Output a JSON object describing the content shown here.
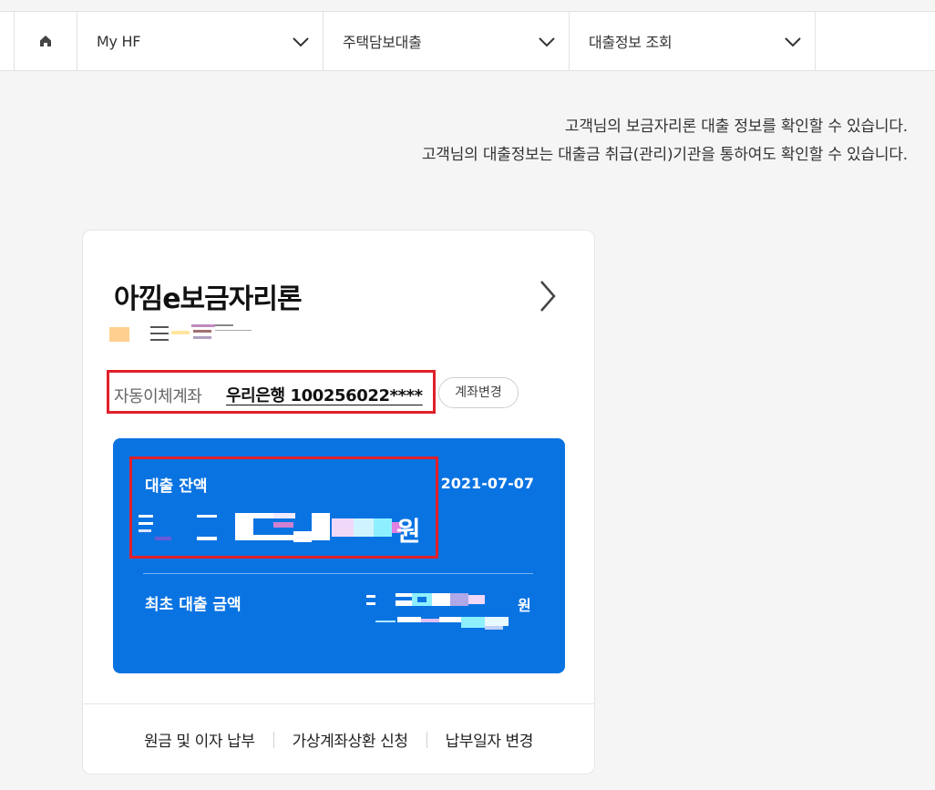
{
  "nav": {
    "home_icon": "home-icon",
    "items": [
      {
        "label": "My HF"
      },
      {
        "label": "주택담보대출"
      },
      {
        "label": "대출정보 조회"
      }
    ]
  },
  "intro": {
    "line1": "고객님의 보금자리론 대출 정보를 확인할 수 있습니다.",
    "line2": "고객님의 대출정보는 대출금 취급(관리)기관을 통하여도 확인할 수 있습니다."
  },
  "card": {
    "title": "아낌e보금자리론",
    "autopay_label": "자동이체계좌",
    "autopay_account": "우리은행 100256022****",
    "change_button": "계좌변경",
    "balance_label": "대출 잔액",
    "balance_date": "2021-07-07",
    "currency": "원",
    "initial_label": "최초 대출 금액",
    "footer": [
      "원금 및 이자 납부",
      "가상계좌상환 신청",
      "납부일자 변경"
    ]
  },
  "colors": {
    "accent_blue": "#0a73e2",
    "highlight_red": "#e0202a"
  }
}
